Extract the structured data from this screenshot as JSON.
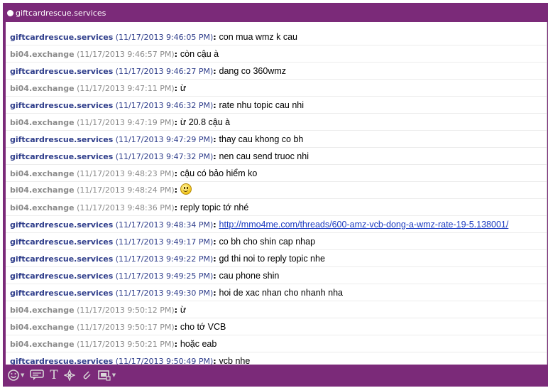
{
  "window": {
    "title": "giftcardrescue.services"
  },
  "messages": [
    {
      "sender": "giftcardrescue.services",
      "time": "(11/17/2013 9:46:05 PM)",
      "text": "con mua wmz k cau",
      "role": "gc"
    },
    {
      "sender": "bi04.exchange",
      "time": "(11/17/2013 9:46:57 PM)",
      "text": "còn cậu à",
      "role": "bi"
    },
    {
      "sender": "giftcardrescue.services",
      "time": "(11/17/2013 9:46:27 PM)",
      "text": "dang co 360wmz",
      "role": "gc"
    },
    {
      "sender": "bi04.exchange",
      "time": "(11/17/2013 9:47:11 PM)",
      "text": "ừ",
      "role": "bi"
    },
    {
      "sender": "giftcardrescue.services",
      "time": "(11/17/2013 9:46:32 PM)",
      "text": "rate nhu topic cau nhi",
      "role": "gc"
    },
    {
      "sender": "bi04.exchange",
      "time": "(11/17/2013 9:47:19 PM)",
      "text": "ừ 20.8 cậu à",
      "role": "bi"
    },
    {
      "sender": "giftcardrescue.services",
      "time": "(11/17/2013 9:47:29 PM)",
      "text": "thay cau khong co bh",
      "role": "gc"
    },
    {
      "sender": "giftcardrescue.services",
      "time": "(11/17/2013 9:47:32 PM)",
      "text": "nen cau send truoc nhi",
      "role": "gc"
    },
    {
      "sender": "bi04.exchange",
      "time": "(11/17/2013 9:48:23 PM)",
      "text": "cậu có bảo hiểm ko",
      "role": "bi"
    },
    {
      "sender": "bi04.exchange",
      "time": "(11/17/2013 9:48:24 PM)",
      "text": "",
      "role": "bi",
      "emoticon": "smiley-emoticon"
    },
    {
      "sender": "bi04.exchange",
      "time": "(11/17/2013 9:48:36 PM)",
      "text": "reply topic tớ nhé",
      "role": "bi"
    },
    {
      "sender": "giftcardrescue.services",
      "time": "(11/17/2013 9:48:34 PM)",
      "text": "http://mmo4me.com/threads/600-amz-vcb-dong-a-wmz-rate-19-5.138001/",
      "role": "gc",
      "link": true
    },
    {
      "sender": "giftcardrescue.services",
      "time": "(11/17/2013 9:49:17 PM)",
      "text": "co bh cho shin cap nhap",
      "role": "gc"
    },
    {
      "sender": "giftcardrescue.services",
      "time": "(11/17/2013 9:49:22 PM)",
      "text": "gd thi noi to reply topic nhe",
      "role": "gc"
    },
    {
      "sender": "giftcardrescue.services",
      "time": "(11/17/2013 9:49:25 PM)",
      "text": "cau phone shin",
      "role": "gc"
    },
    {
      "sender": "giftcardrescue.services",
      "time": "(11/17/2013 9:49:30 PM)",
      "text": "hoi de xac nhan cho nhanh nha",
      "role": "gc"
    },
    {
      "sender": "bi04.exchange",
      "time": "(11/17/2013 9:50:12 PM)",
      "text": "ừ",
      "role": "bi"
    },
    {
      "sender": "bi04.exchange",
      "time": "(11/17/2013 9:50:17 PM)",
      "text": "cho tớ VCB",
      "role": "bi"
    },
    {
      "sender": "bi04.exchange",
      "time": "(11/17/2013 9:50:21 PM)",
      "text": "hoặc eab",
      "role": "bi"
    },
    {
      "sender": "giftcardrescue.services",
      "time": "(11/17/2013 9:50:49 PM)",
      "text": "vcb nhe",
      "role": "gc"
    }
  ],
  "toolbar": {
    "buttons": [
      {
        "name": "smiley-icon",
        "dropdown": true
      },
      {
        "name": "chat-bubble-icon",
        "dropdown": false
      },
      {
        "name": "text-format-icon",
        "glyph": "T",
        "dropdown": false
      },
      {
        "name": "attention-icon",
        "dropdown": false
      },
      {
        "name": "attachment-icon",
        "dropdown": false
      },
      {
        "name": "insert-image-icon",
        "dropdown": true
      }
    ]
  },
  "colors": {
    "frame": "#7b2a79",
    "sender_primary": "#2d3c8a",
    "sender_secondary": "#8a8a8a",
    "link": "#1a3ac0"
  }
}
